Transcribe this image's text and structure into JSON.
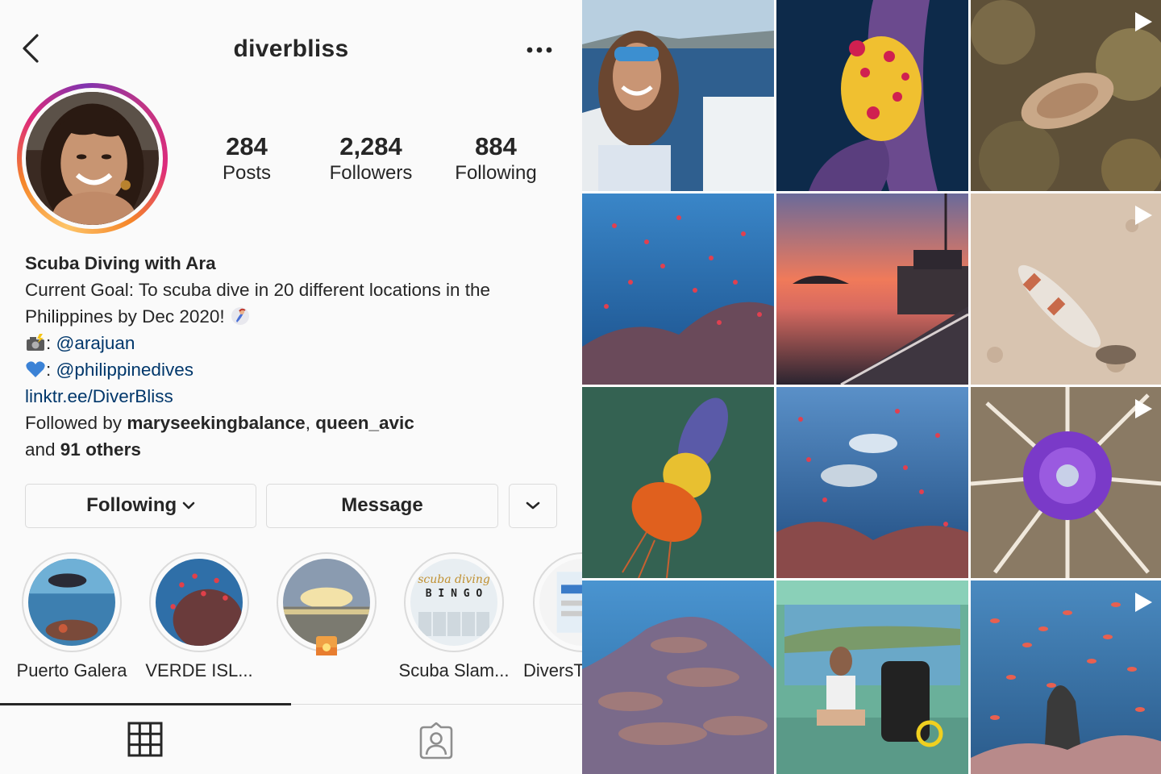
{
  "header": {
    "username": "diverbliss",
    "back_icon": "chevron-left-icon",
    "more_icon": "more-horizontal-icon"
  },
  "stats": {
    "posts": {
      "value": "284",
      "label": "Posts"
    },
    "followers": {
      "value": "2,284",
      "label": "Followers"
    },
    "following": {
      "value": "884",
      "label": "Following"
    }
  },
  "bio": {
    "name": "Scuba Diving with Ara",
    "line1": "Current Goal: To scuba dive in 20 different locations in the Philippines by Dec 2020!",
    "photo_sep": ": ",
    "photo_credit": "@arajuan",
    "heart_sep": ": ",
    "partner": "@philippinedives",
    "link": "linktr.ee/DiverBliss",
    "followed_prefix": "Followed by ",
    "followed_user1": "maryseekingbalance",
    "followed_comma": ", ",
    "followed_user2": "queen_avic",
    "followed_and": "and ",
    "followed_others": "91 others"
  },
  "actions": {
    "following_label": "Following",
    "message_label": "Message"
  },
  "highlights": [
    {
      "label": "Puerto Galera"
    },
    {
      "label": "VERDE ISL..."
    },
    {
      "label": ""
    },
    {
      "label": "Scuba Slam..."
    },
    {
      "label": "DiversT"
    }
  ],
  "highlight_bingo_text": {
    "script": "scuba diving",
    "word": "B I N G O"
  },
  "tabs": {
    "grid_icon": "grid-icon",
    "tagged_icon": "tagged-user-icon"
  },
  "colors": {
    "link": "#00376b",
    "text": "#262626",
    "border": "#dbdbdb"
  },
  "posts": [
    {
      "subject": "selfie on boat",
      "video": false
    },
    {
      "subject": "frogfish",
      "video": false
    },
    {
      "subject": "reef creature",
      "video": true
    },
    {
      "subject": "fish school reef",
      "video": false
    },
    {
      "subject": "sunset boat deck",
      "video": false
    },
    {
      "subject": "shrimp goby",
      "video": true
    },
    {
      "subject": "ghost net",
      "video": false
    },
    {
      "subject": "divers with anthias",
      "video": false
    },
    {
      "subject": "tube anemone",
      "video": true
    },
    {
      "subject": "coral reef",
      "video": false
    },
    {
      "subject": "diver on boat",
      "video": false
    },
    {
      "subject": "anthias over coral",
      "video": true
    }
  ]
}
